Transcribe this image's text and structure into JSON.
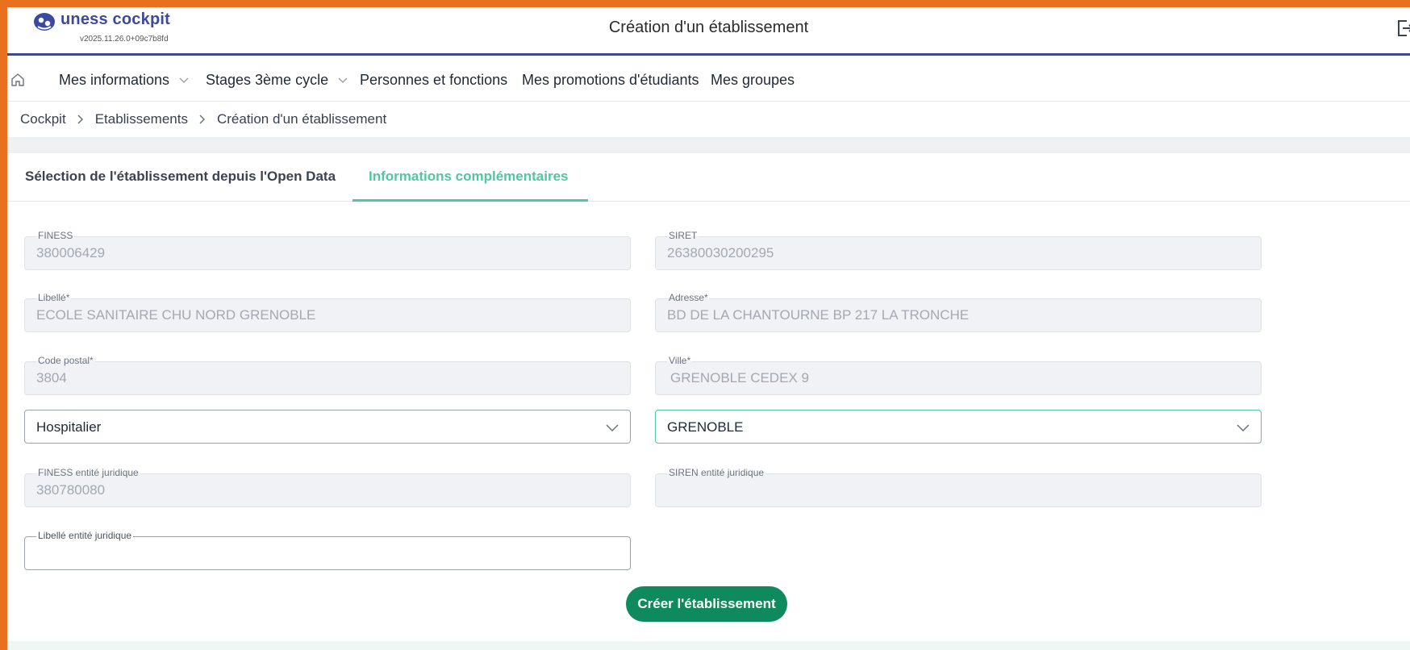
{
  "app": {
    "logo_text": "uness cockpit",
    "version": "v2025.11.26.0+09c7b8fd",
    "page_title": "Création d'un établissement"
  },
  "nav": {
    "items": [
      {
        "label": "Mes informations",
        "has_dropdown": true
      },
      {
        "label": "Stages 3ème cycle",
        "has_dropdown": true
      },
      {
        "label": "Personnes et fonctions",
        "has_dropdown": false
      },
      {
        "label": "Mes promotions d'étudiants",
        "has_dropdown": false
      },
      {
        "label": "Mes groupes",
        "has_dropdown": false
      }
    ]
  },
  "breadcrumb": [
    "Cockpit",
    "Etablissements",
    "Création d'un établissement"
  ],
  "tabs": [
    {
      "label": "Sélection de l'établissement depuis l'Open Data",
      "active": false
    },
    {
      "label": "Informations complémentaires",
      "active": true
    }
  ],
  "form": {
    "finess": {
      "label": "FINESS",
      "value": "380006429"
    },
    "siret": {
      "label": "SIRET",
      "value": "26380030200295"
    },
    "libelle": {
      "label": "Libellé*",
      "value": "ECOLE SANITAIRE CHU NORD GRENOBLE"
    },
    "adresse": {
      "label": "Adresse*",
      "value": "BD DE LA CHANTOURNE BP 217 LA TRONCHE"
    },
    "code_postal": {
      "label": "Code postal*",
      "value": "3804"
    },
    "ville": {
      "label": "Ville*",
      "value": "GRENOBLE CEDEX 9"
    },
    "type_select": {
      "value": "Hospitalier"
    },
    "city_select": {
      "value": "GRENOBLE"
    },
    "finess_ej": {
      "label": "FINESS entité juridique",
      "value": "380780080"
    },
    "siren_ej": {
      "label": "SIREN entité juridique",
      "value": ""
    },
    "libelle_ej": {
      "label": "Libellé entité juridique",
      "value": ""
    },
    "submit_label": "Créer l'établissement"
  },
  "colors": {
    "frame": "#e8701e",
    "brand": "#3b4aa0",
    "accent": "#4fc7a0",
    "button": "#0f8a5f"
  }
}
